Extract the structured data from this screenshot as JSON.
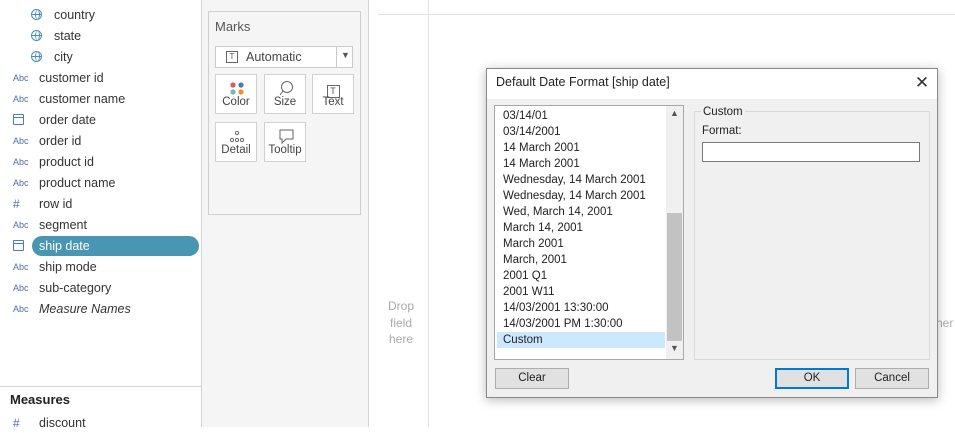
{
  "data_pane": {
    "dimensions": [
      {
        "label": "country",
        "type": "geo",
        "indent": true
      },
      {
        "label": "state",
        "type": "geo",
        "indent": true
      },
      {
        "label": "city",
        "type": "geo",
        "indent": true
      },
      {
        "label": "customer id",
        "type": "string",
        "indent": false
      },
      {
        "label": "customer name",
        "type": "string",
        "indent": false
      },
      {
        "label": "order date",
        "type": "date",
        "indent": false
      },
      {
        "label": "order id",
        "type": "string",
        "indent": false
      },
      {
        "label": "product id",
        "type": "string",
        "indent": false
      },
      {
        "label": "product name",
        "type": "string",
        "indent": false
      },
      {
        "label": "row id",
        "type": "number",
        "indent": false
      },
      {
        "label": "segment",
        "type": "string",
        "indent": false
      },
      {
        "label": "ship date",
        "type": "date",
        "indent": false,
        "selected": true
      },
      {
        "label": "ship mode",
        "type": "string",
        "indent": false
      },
      {
        "label": "sub-category",
        "type": "string",
        "indent": false
      },
      {
        "label": "Measure Names",
        "type": "string",
        "indent": false,
        "italic": true
      }
    ],
    "type_labels": {
      "string": "Abc",
      "number": "#"
    },
    "measures_header": "Measures",
    "measures": [
      {
        "label": "discount",
        "type": "number"
      }
    ]
  },
  "marks": {
    "title": "Marks",
    "mark_type": "Automatic",
    "type_icon": "T",
    "buttons": [
      {
        "label": "Color",
        "icon": "color-dots-icon"
      },
      {
        "label": "Size",
        "icon": "size-bubble-icon"
      },
      {
        "label": "Text",
        "icon": "text-box-icon",
        "glyph": "T"
      },
      {
        "label": "Detail",
        "icon": "detail-dots-icon"
      },
      {
        "label": "Tooltip",
        "icon": "tooltip-bubble-icon"
      }
    ],
    "color_dot_colors": [
      "#e15759",
      "#4e79a7",
      "#76b7b2",
      "#f28e2b"
    ]
  },
  "canvas": {
    "drop_field_lines": [
      "Drop",
      "field",
      "here"
    ],
    "drop_other_partial": "her"
  },
  "dialog": {
    "title": "Default Date Format [ship date]",
    "formats": [
      "03/14/01",
      "03/14/2001",
      "14 March 2001",
      "14 March 2001",
      "Wednesday, 14 March 2001",
      "Wednesday, 14 March 2001",
      "Wed, March 14, 2001",
      "March 14, 2001",
      "March 2001",
      "March, 2001",
      "2001 Q1",
      "2001 W11",
      "14/03/2001 13:30:00",
      "14/03/2001 PM 1:30:00",
      "Custom"
    ],
    "selected_format": "Custom",
    "custom_group_label": "Custom",
    "format_label": "Format:",
    "format_value": "",
    "buttons": {
      "clear": "Clear",
      "ok": "OK",
      "cancel": "Cancel"
    },
    "selection_color": "#cce8ff",
    "default_button_border": "#0078d7"
  },
  "accent": "#4996b2"
}
